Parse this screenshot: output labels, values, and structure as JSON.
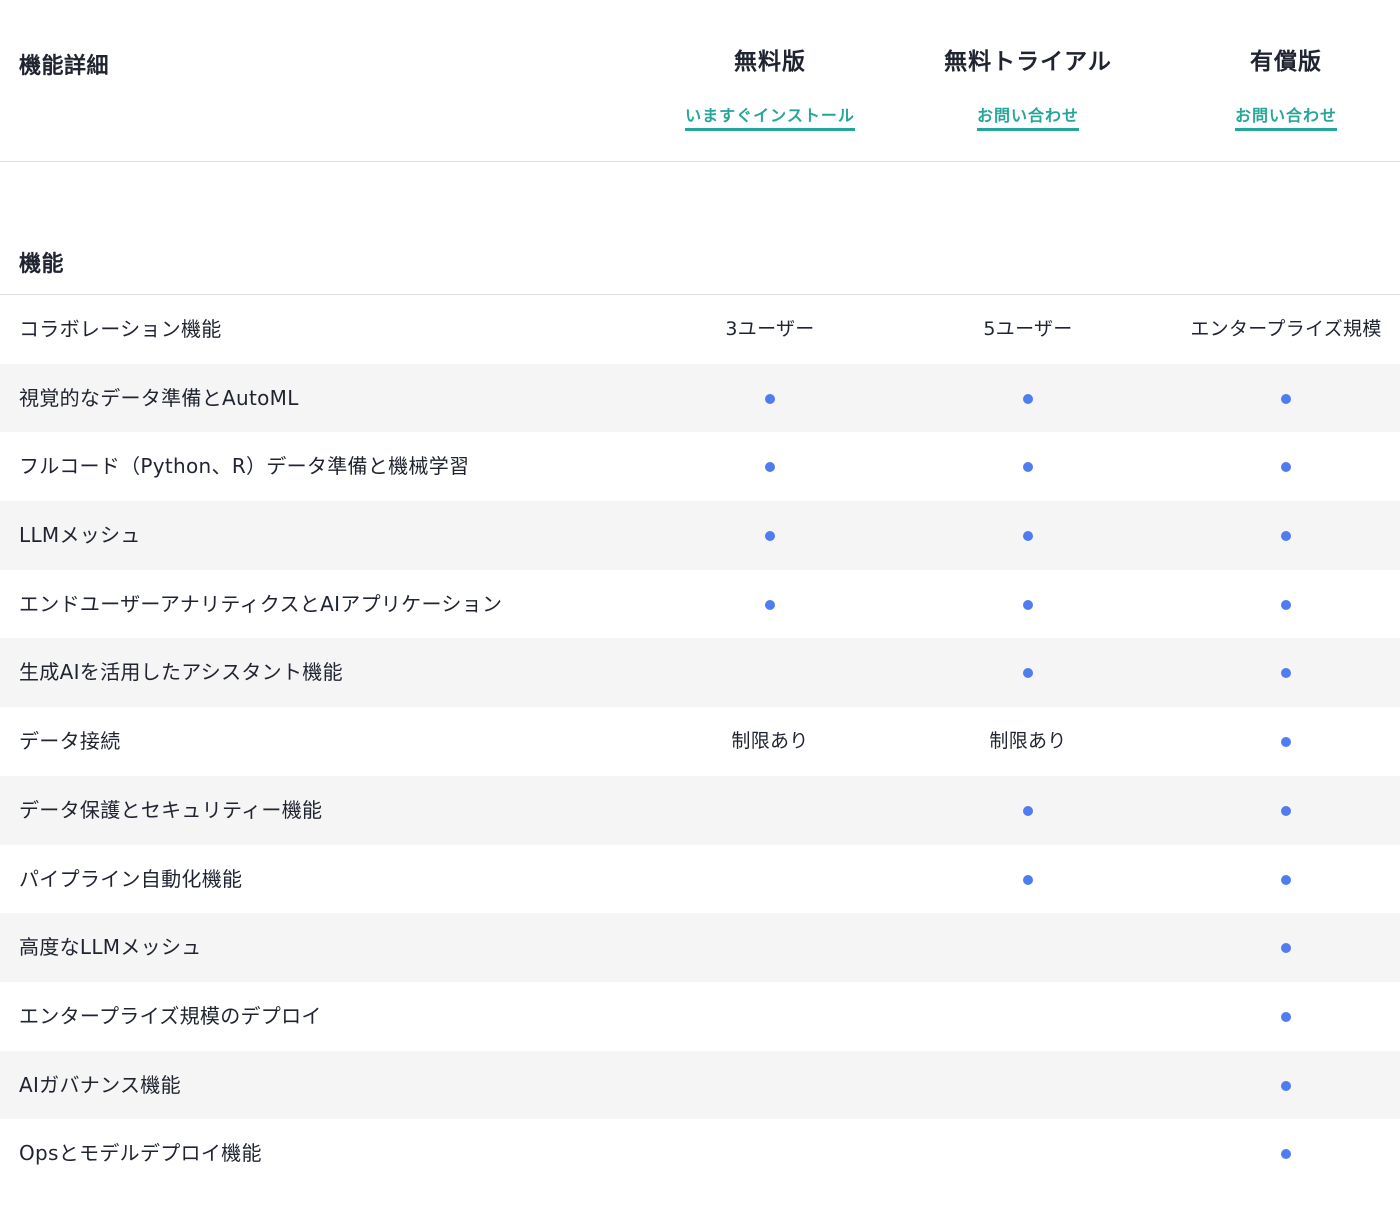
{
  "header": {
    "title": "機能詳細",
    "plans": [
      {
        "name": "無料版",
        "link": "いますぐインストール"
      },
      {
        "name": "無料トライアル",
        "link": "お問い合わせ"
      },
      {
        "name": "有償版",
        "link": "お問い合わせ"
      }
    ]
  },
  "section": {
    "title": "機能"
  },
  "colors": {
    "accent": "#26a69a",
    "dot": "#4f7cf0",
    "alt_row": "#f5f5f5"
  },
  "features": [
    {
      "name": "コラボレーション機能",
      "cells": [
        "3ユーザー",
        "5ユーザー",
        "エンタープライズ規模"
      ]
    },
    {
      "name": "視覚的なデータ準備とAutoML",
      "cells": [
        "dot",
        "dot",
        "dot"
      ]
    },
    {
      "name": "フルコード（Python、R）データ準備と機械学習",
      "cells": [
        "dot",
        "dot",
        "dot"
      ]
    },
    {
      "name": "LLMメッシュ",
      "cells": [
        "dot",
        "dot",
        "dot"
      ]
    },
    {
      "name": "エンドユーザーアナリティクスとAIアプリケーション",
      "cells": [
        "dot",
        "dot",
        "dot"
      ]
    },
    {
      "name": "生成AIを活用したアシスタント機能",
      "cells": [
        "",
        "dot",
        "dot"
      ]
    },
    {
      "name": "データ接続",
      "cells": [
        "制限あり",
        "制限あり",
        "dot"
      ]
    },
    {
      "name": "データ保護とセキュリティー機能",
      "cells": [
        "",
        "dot",
        "dot"
      ]
    },
    {
      "name": "パイプライン自動化機能",
      "cells": [
        "",
        "dot",
        "dot"
      ]
    },
    {
      "name": "高度なLLMメッシュ",
      "cells": [
        "",
        "",
        "dot"
      ]
    },
    {
      "name": "エンタープライズ規模のデプロイ",
      "cells": [
        "",
        "",
        "dot"
      ]
    },
    {
      "name": "AIガバナンス機能",
      "cells": [
        "",
        "",
        "dot"
      ]
    },
    {
      "name": "Opsとモデルデプロイ機能",
      "cells": [
        "",
        "",
        "dot"
      ]
    }
  ]
}
